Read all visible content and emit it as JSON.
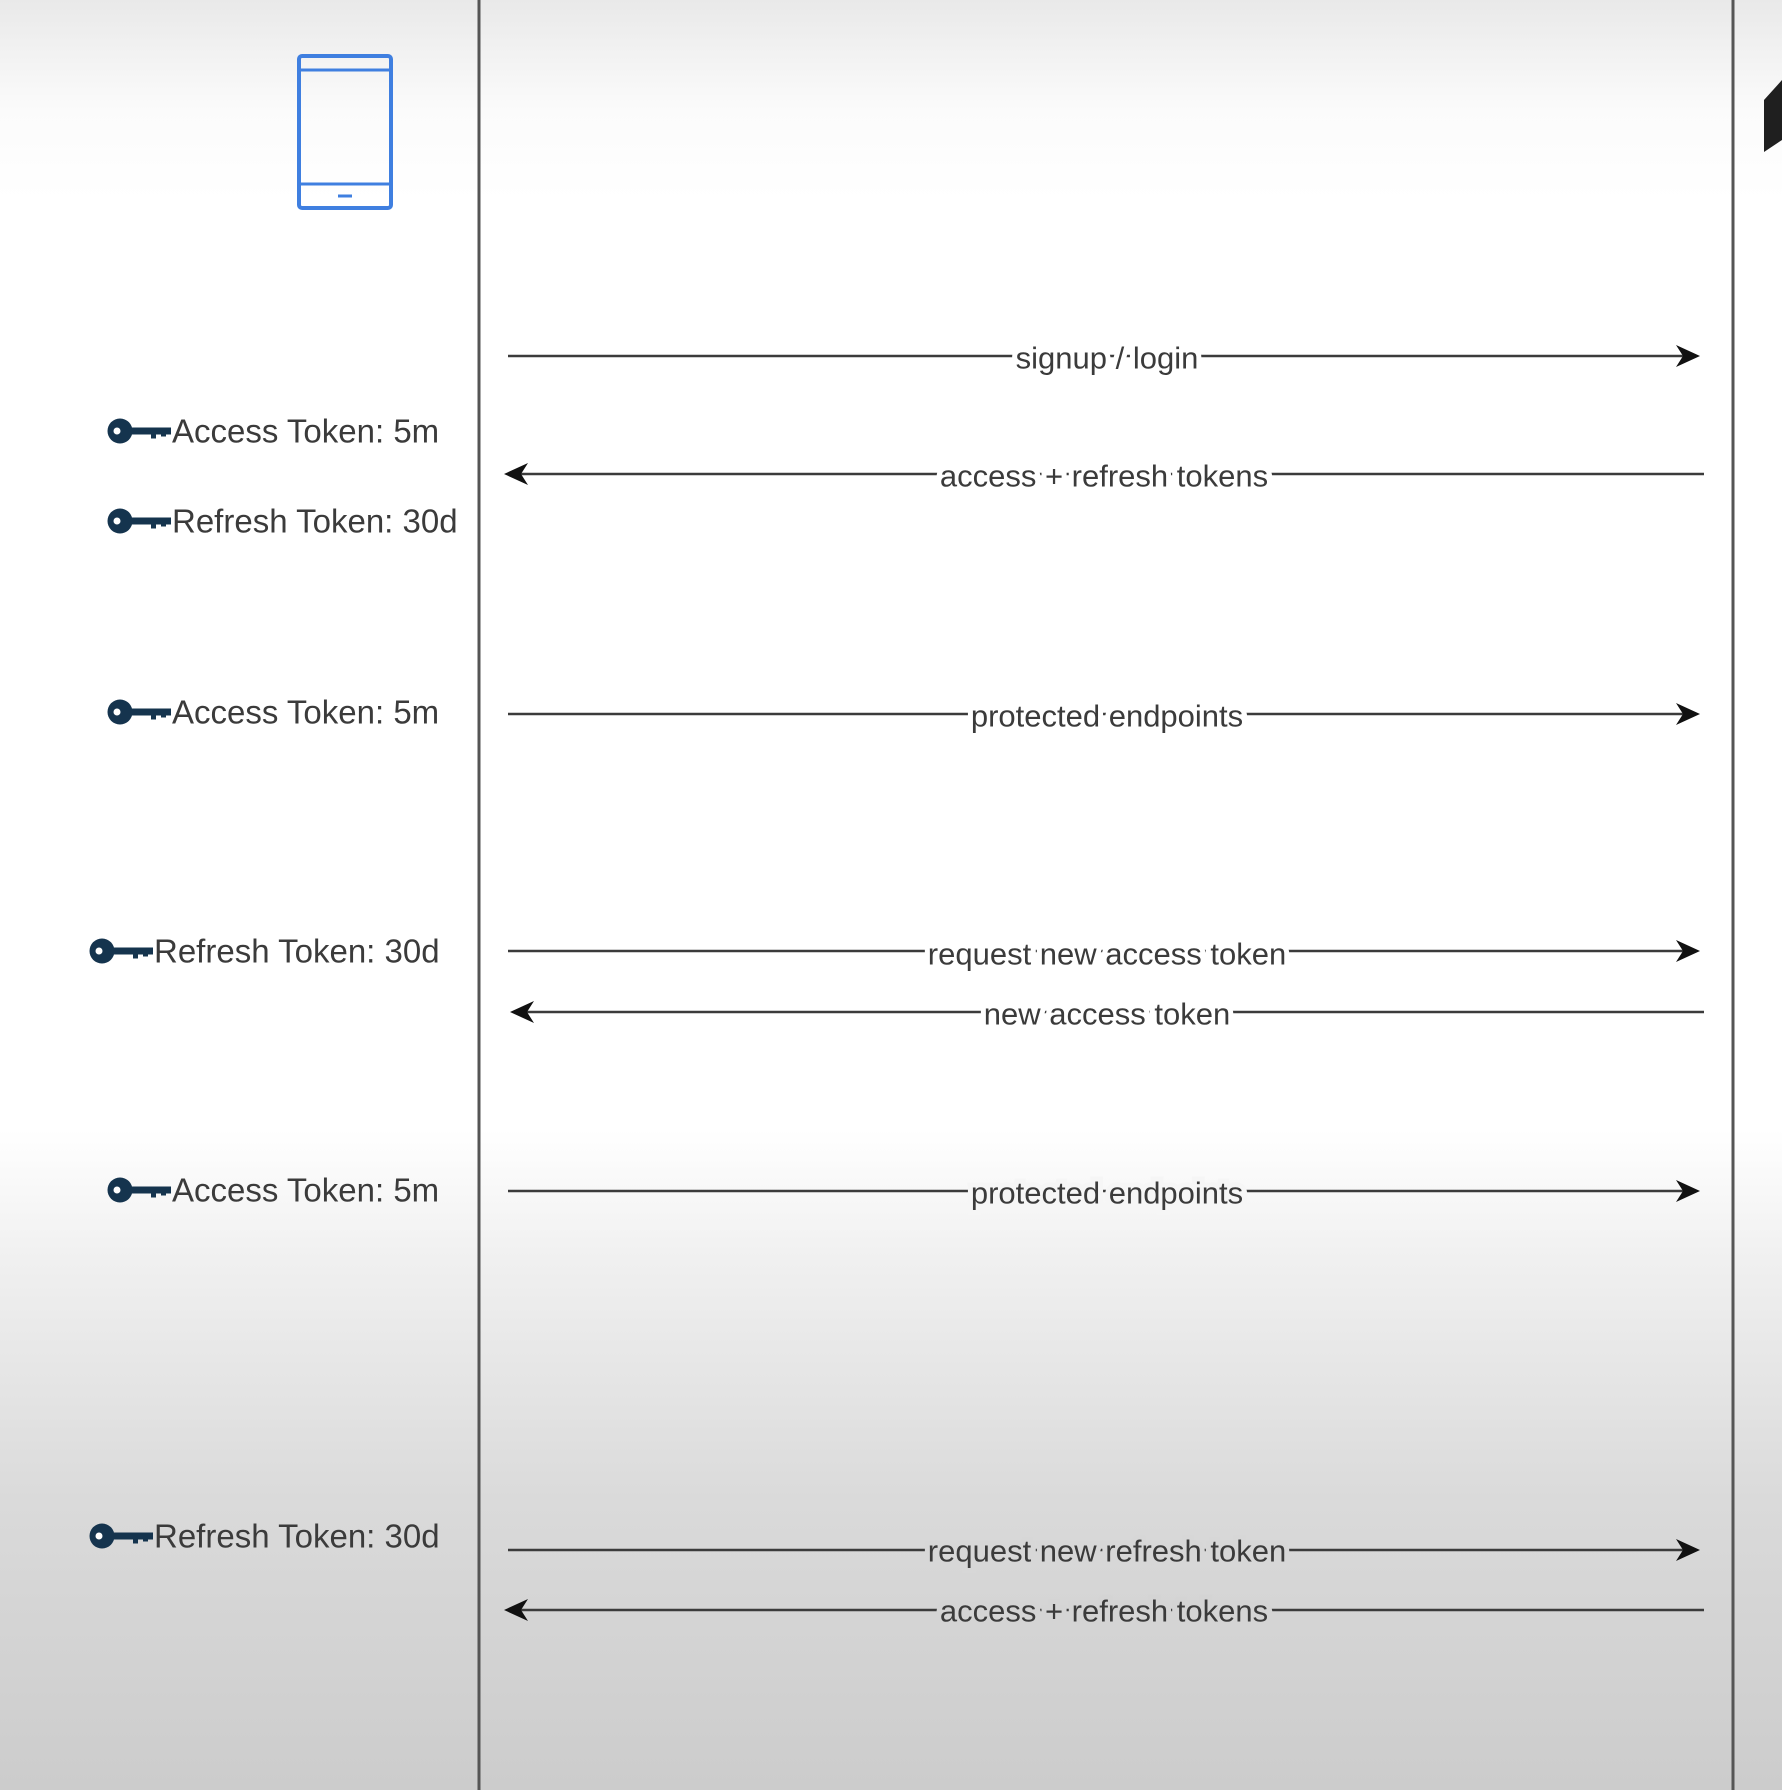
{
  "lifelines": {
    "left": {
      "name": "client-lifeline"
    },
    "right": {
      "name": "server-lifeline"
    }
  },
  "client_icon": {
    "icon": "mobile-phone-icon",
    "color": "#3f7fe0"
  },
  "key_icon": {
    "icon": "key-icon",
    "color": "#15344e"
  },
  "token_labels": [
    {
      "text": "Access Token: 5m"
    },
    {
      "text": "Refresh Token: 30d"
    },
    {
      "text": "Access Token: 5m"
    },
    {
      "text": "Refresh Token: 30d"
    },
    {
      "text": "Access Token: 5m"
    },
    {
      "text": "Refresh Token: 30d"
    }
  ],
  "messages": [
    {
      "text": "signup / login",
      "direction": "right"
    },
    {
      "text": "access + refresh tokens",
      "direction": "left"
    },
    {
      "text": "protected endpoints",
      "direction": "right"
    },
    {
      "text": "request new access token",
      "direction": "right"
    },
    {
      "text": "new access token",
      "direction": "left"
    },
    {
      "text": "protected endpoints",
      "direction": "right"
    },
    {
      "text": "request new refresh token",
      "direction": "right"
    },
    {
      "text": "access + refresh tokens",
      "direction": "left"
    }
  ]
}
